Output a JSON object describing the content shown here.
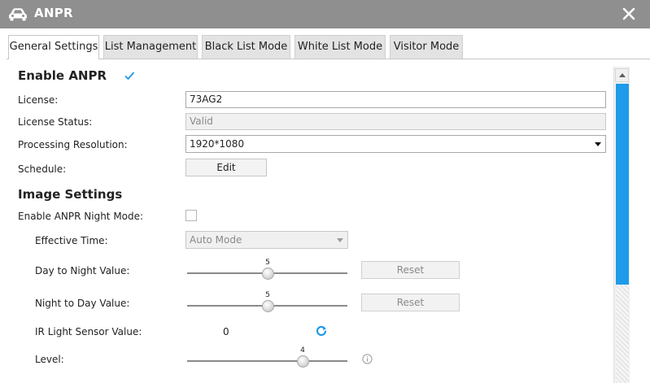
{
  "window": {
    "title": "ANPR",
    "icon": "car-icon",
    "close_icon": "close-icon"
  },
  "tabs": [
    {
      "label": "General Settings",
      "active": true
    },
    {
      "label": "List Management",
      "active": false
    },
    {
      "label": "Black List Mode",
      "active": false
    },
    {
      "label": "White List Mode",
      "active": false
    },
    {
      "label": "Visitor Mode",
      "active": false
    }
  ],
  "general": {
    "enable_anpr_label": "Enable ANPR",
    "enable_anpr_checked": true,
    "license_label": "License:",
    "license_value": "73AG2",
    "license_status_label": "License Status:",
    "license_status_value": "Valid",
    "processing_resolution_label": "Processing Resolution:",
    "processing_resolution_value": "1920*1080",
    "schedule_label": "Schedule:",
    "schedule_button": "Edit"
  },
  "image_settings": {
    "title": "Image Settings",
    "night_mode_label": "Enable ANPR Night Mode:",
    "night_mode_checked": false,
    "effective_time_label": "Effective Time:",
    "effective_time_value": "Auto Mode",
    "day_to_night_label": "Day to Night Value:",
    "day_to_night_value": "5",
    "day_to_night_fraction": 0.5,
    "night_to_day_label": "Night to Day Value:",
    "night_to_day_value": "5",
    "night_to_day_fraction": 0.5,
    "reset_label": "Reset",
    "ir_sensor_label": "IR Light Sensor Value:",
    "ir_sensor_value": "0",
    "level_label": "Level:",
    "level_value": "4",
    "level_fraction": 0.72
  },
  "colors": {
    "titlebar": "#8f8f8f",
    "accent": "#1e9be9",
    "check": "#1e9be9"
  }
}
